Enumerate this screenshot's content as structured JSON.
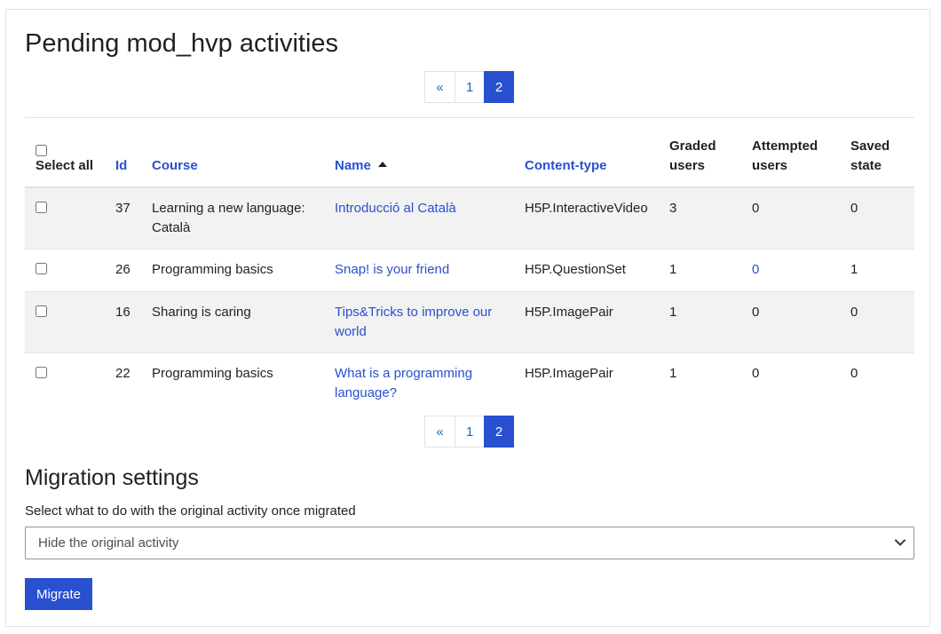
{
  "heading": "Pending mod_hvp activities",
  "pagination": {
    "prev": "«",
    "pages": [
      "1",
      "2"
    ],
    "active": "2"
  },
  "table": {
    "select_all": "Select all",
    "columns": {
      "id": "Id",
      "course": "Course",
      "name": "Name",
      "content_type": "Content-type",
      "graded": "Graded users",
      "attempted": "Attempted users",
      "saved": "Saved state"
    },
    "sort": {
      "column": "Name",
      "direction": "ascending"
    },
    "rows": [
      {
        "id": "37",
        "course": "Learning a new language: Català",
        "name": "Introducció al Català",
        "content_type": "H5P.InteractiveVideo",
        "graded": "3",
        "attempted": "0",
        "saved": "0"
      },
      {
        "id": "26",
        "course": "Programming basics",
        "name": "Snap! is your friend",
        "content_type": "H5P.QuestionSet",
        "graded": "1",
        "attempted": "0",
        "saved": "1"
      },
      {
        "id": "16",
        "course": "Sharing is caring",
        "name": "Tips&Tricks to improve our world",
        "content_type": "H5P.ImagePair",
        "graded": "1",
        "attempted": "0",
        "saved": "0"
      },
      {
        "id": "22",
        "course": "Programming basics",
        "name": "What is a programming language?",
        "content_type": "H5P.ImagePair",
        "graded": "1",
        "attempted": "0",
        "saved": "0"
      }
    ]
  },
  "settings": {
    "heading": "Migration settings",
    "label": "Select what to do with the original activity once migrated",
    "selected": "Hide the original activity",
    "button": "Migrate"
  },
  "colors": {
    "accent": "#2950cf",
    "link": "#0f6cbf",
    "stripe": "#f2f2f2",
    "border": "#dee2e6"
  },
  "icons": [
    "sort-ascending-icon",
    "chevron-down-icon"
  ]
}
